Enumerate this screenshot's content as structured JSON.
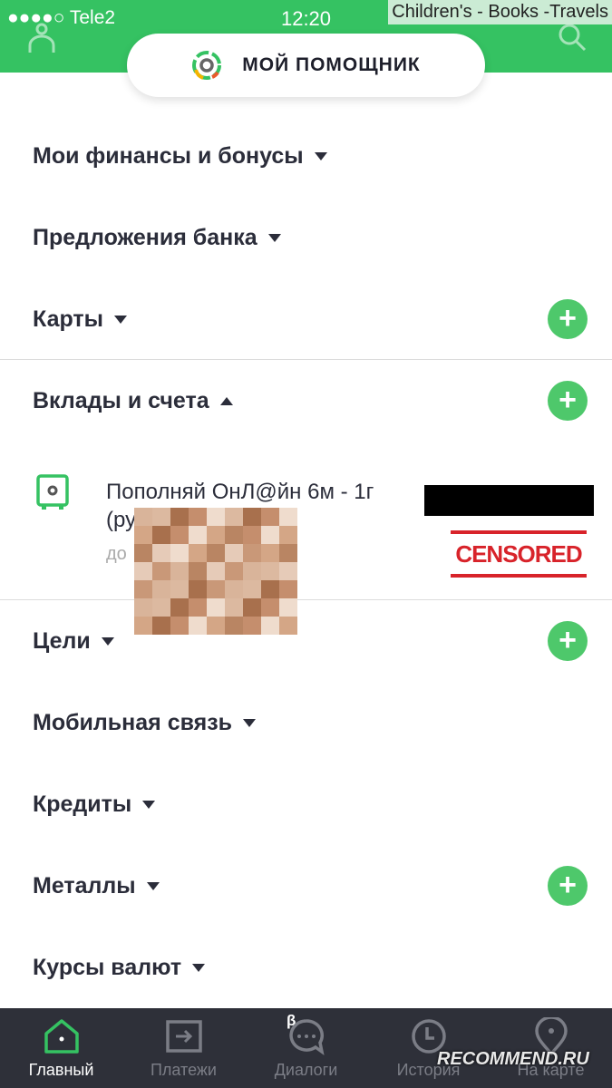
{
  "status_bar": {
    "carrier": "●●●●○ Tele2",
    "time": "12:20"
  },
  "watermark_top": "Children's - Books -Travels",
  "watermark_bottom": "RECOMMEND.RU",
  "header": {
    "title": "МОЙ ПОМОЩНИК",
    "accent": "#35c262"
  },
  "sections": [
    {
      "label": "Мои финансы и бонусы",
      "expanded": false,
      "add": false
    },
    {
      "label": "Предложения банка",
      "expanded": false,
      "add": false
    },
    {
      "label": "Карты",
      "expanded": false,
      "add": true
    },
    {
      "label": "Вклады и счета",
      "expanded": true,
      "add": true
    },
    {
      "label": "Цели",
      "expanded": false,
      "add": true
    },
    {
      "label": "Мобильная связь",
      "expanded": false,
      "add": false
    },
    {
      "label": "Кредиты",
      "expanded": false,
      "add": false
    },
    {
      "label": "Металлы",
      "expanded": false,
      "add": true
    },
    {
      "label": "Курсы валют",
      "expanded": false,
      "add": false
    }
  ],
  "account": {
    "name": "Пополняй ОнЛ@йн 6м - 1г (руб.)",
    "sub": "до",
    "icon": "safe-icon",
    "stamp": "CENSORED"
  },
  "tabs": [
    {
      "label": "Главный",
      "icon": "home-icon",
      "active": true
    },
    {
      "label": "Платежи",
      "icon": "payments-icon",
      "active": false
    },
    {
      "label": "Диалоги",
      "icon": "chat-icon",
      "active": false,
      "badge": "β"
    },
    {
      "label": "История",
      "icon": "clock-icon",
      "active": false
    },
    {
      "label": "На карте",
      "icon": "map-pin-icon",
      "active": false
    }
  ]
}
